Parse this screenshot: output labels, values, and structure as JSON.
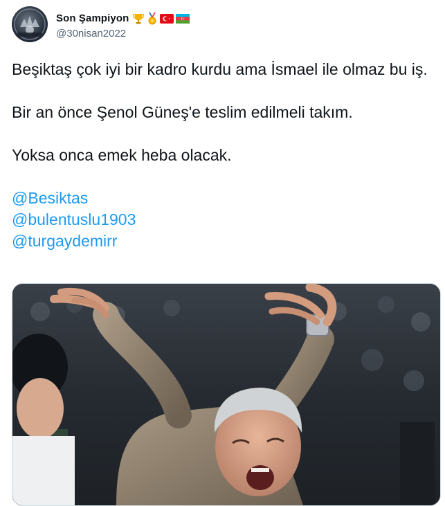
{
  "user": {
    "display_name": "Son Şampiyon",
    "handle": "@30nisan2022",
    "avatar_icon": "avatar-image",
    "badges": [
      "trophy-icon",
      "medal-icon",
      "turkey-flag-icon",
      "azerbaijan-flag-icon"
    ]
  },
  "tweet": {
    "paragraphs": [
      "Beşiktaş çok iyi bir kadro kurdu ama İsmael ile olmaz bu iş.",
      "Bir an önce Şenol Güneş'e teslim edilmeli takım.",
      "Yoksa onca emek heba olacak."
    ],
    "mentions": [
      "@Besiktas",
      "@bulentuslu1903",
      "@turgaydemirr"
    ]
  },
  "media": {
    "icon": "tweet-photo-coach-celebrating"
  },
  "colors": {
    "link": "#1d9bf0",
    "text": "#0f1419",
    "secondary": "#536471",
    "border": "#cfd9de"
  }
}
